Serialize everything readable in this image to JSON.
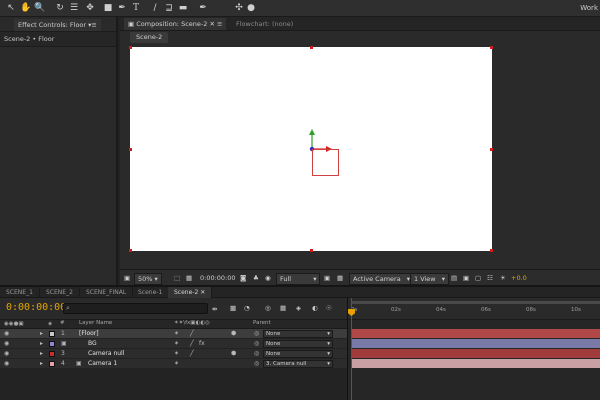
{
  "toolbar": {
    "tools": [
      "selection-tool",
      "hand-tool",
      "zoom-tool",
      "rotate-tool",
      "camera-tool",
      "pan-behind-tool",
      "shape-tool",
      "pen-tool",
      "type-tool",
      "brush-tool",
      "clone-stamp-tool",
      "eraser-tool",
      "roto-brush-tool",
      "puppet-tool"
    ],
    "type_glyph": "T",
    "workspace_label": "Work"
  },
  "effect_controls": {
    "tab_label": "Effect Controls: Floor",
    "breadcrumb": "Scene-2 • Floor"
  },
  "composition": {
    "tab_label": "Composition: Scene-2",
    "flowchart_label": "Flowchart: (none)",
    "subtab_label": "Scene-2",
    "canvas_color": "#ffffff"
  },
  "viewer_footer": {
    "zoom": "50%",
    "timecode": "0:00:00:00",
    "resolution": "Full",
    "camera": "Active Camera",
    "views": "1 View",
    "exposure": "+0.0"
  },
  "timeline": {
    "tabs": [
      "SCENE_1",
      "SCENE_2",
      "SCENE_FINAL",
      "Scene-1",
      "Scene-2"
    ],
    "active_tab_index": 4,
    "current_time": "0:00:00:00",
    "columns": {
      "number": "#",
      "layer_name": "Layer Name",
      "parent": "Parent"
    },
    "layers": [
      {
        "num": "1",
        "name": "[Floor]",
        "color": "#c8c8c8",
        "parent": "None",
        "bar": "#b04848",
        "selected": true
      },
      {
        "num": "2",
        "name": "BG",
        "color": "#8a8ad0",
        "parent": "None",
        "bar": "#7a7aa8",
        "selected": false
      },
      {
        "num": "3",
        "name": "Camera null",
        "color": "#c83030",
        "parent": "None",
        "bar": "#a03c3c",
        "selected": false
      },
      {
        "num": "4",
        "name": "Camera 1",
        "color": "#e8a0a8",
        "parent": "3. Camera null",
        "bar": "#c8a0a4",
        "selected": false
      }
    ],
    "ruler": [
      "0s",
      "02s",
      "04s",
      "06s",
      "08s",
      "10s"
    ],
    "accent": "#e6a300"
  }
}
